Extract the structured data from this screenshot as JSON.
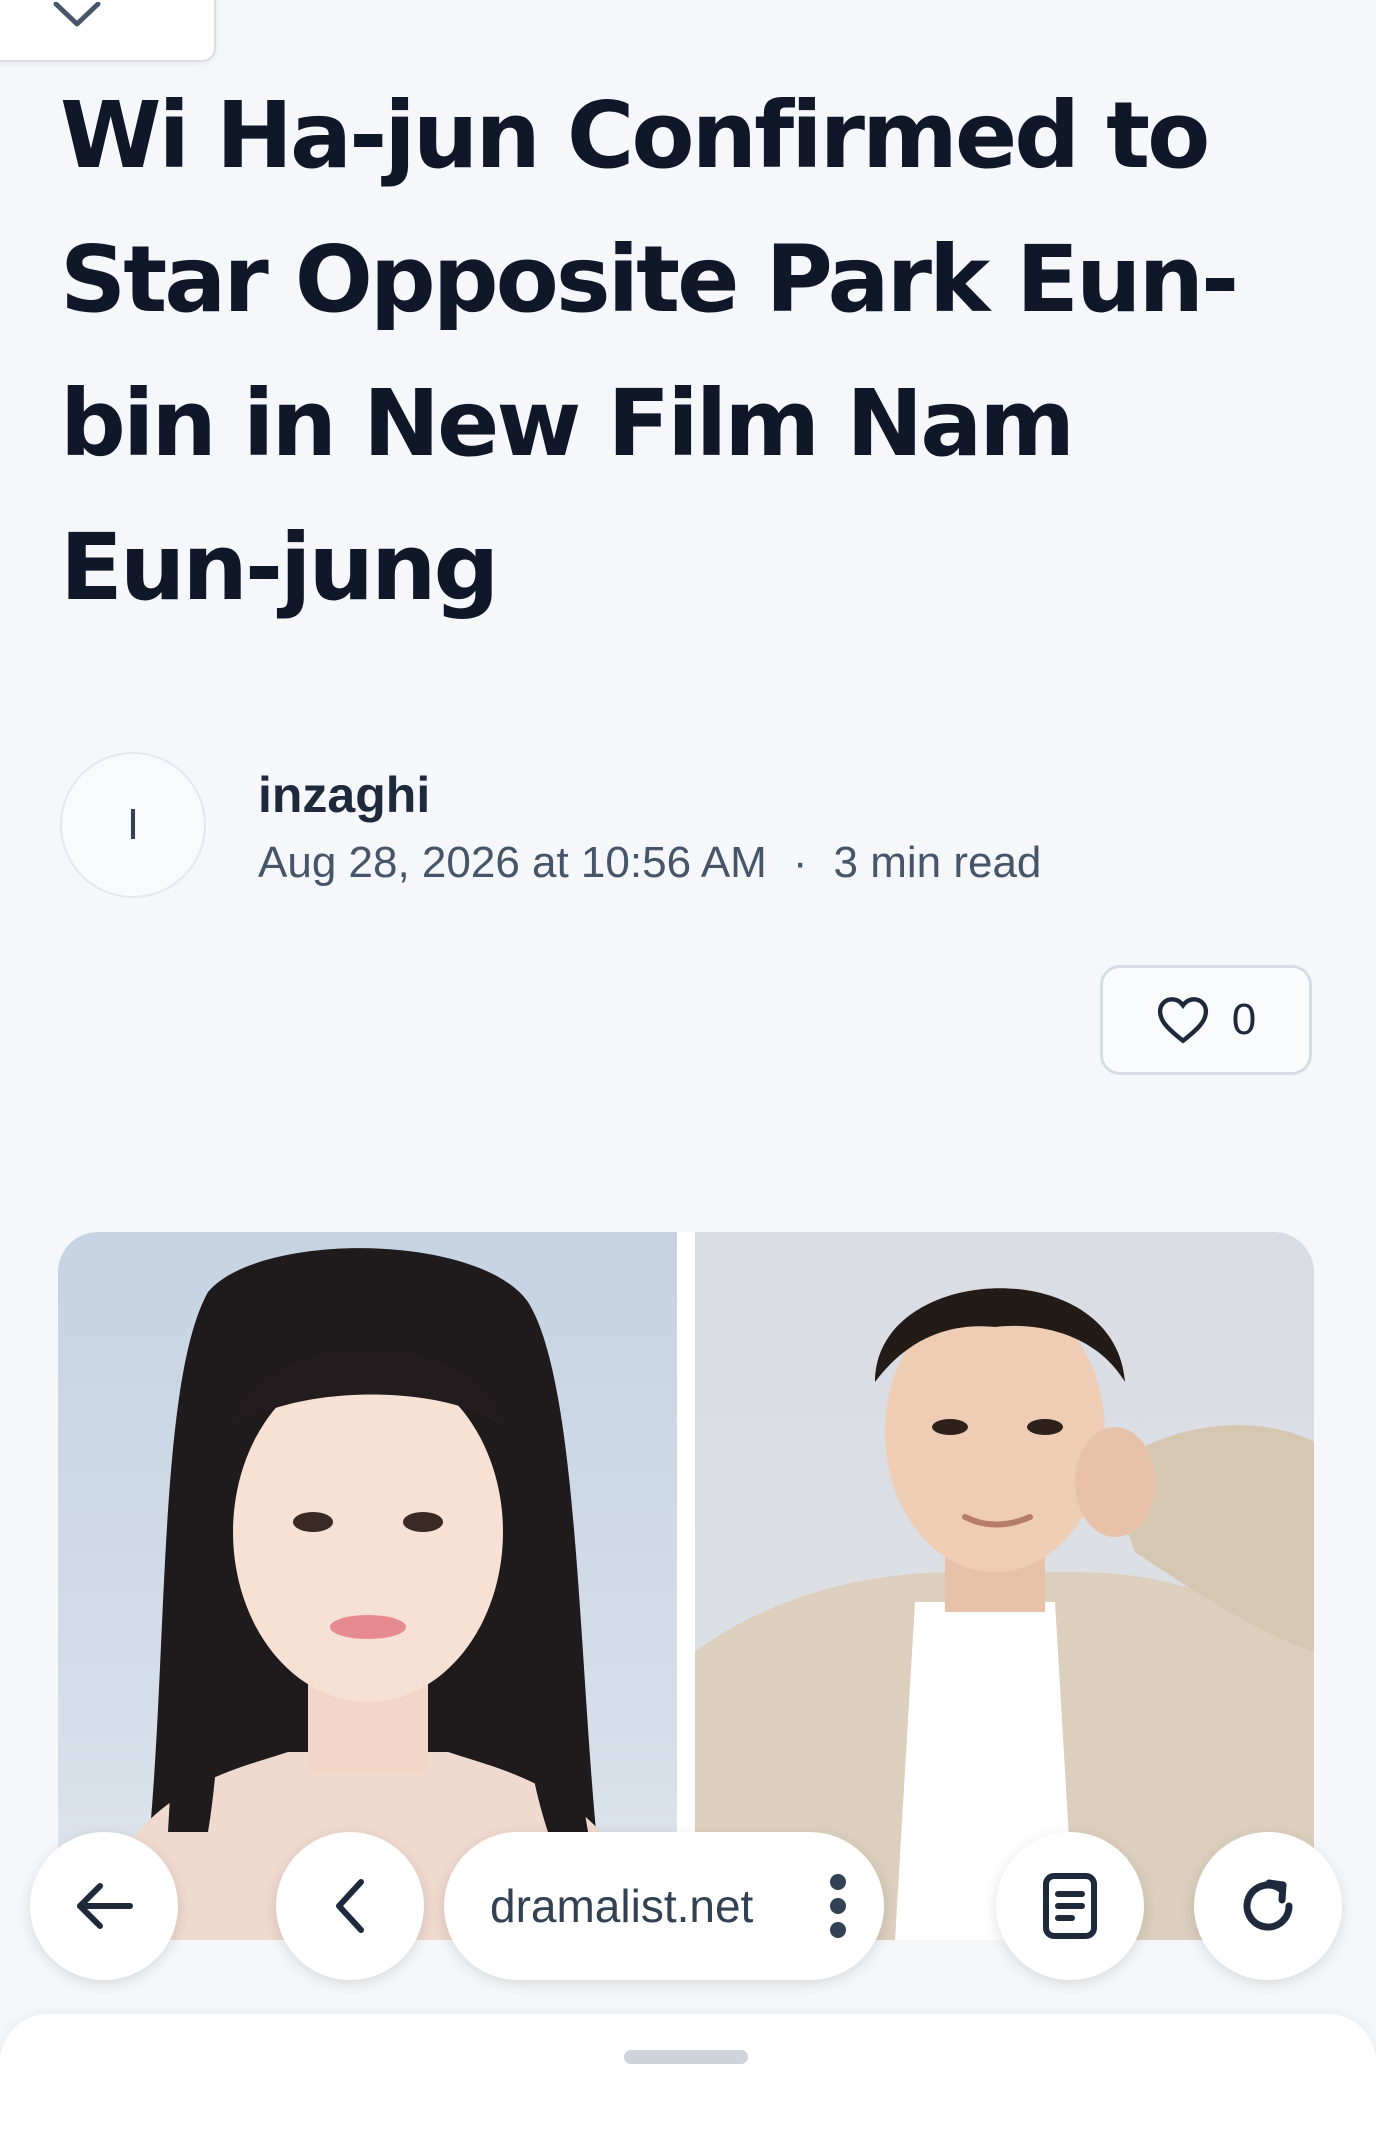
{
  "article": {
    "title": "Wi Ha-jun Confirmed to Star Opposite Park Eun-bin in New Film Nam Eun-jung",
    "author": {
      "initial": "I",
      "name": "inzaghi"
    },
    "date": "Aug 28, 2026 at 10:56 AM",
    "separator": "·",
    "read_time": "3 min read",
    "likes": "0"
  },
  "browser": {
    "url": "dramalist.net"
  },
  "icons": {
    "dropdown": "chevron-down-icon",
    "like": "heart-icon",
    "back": "arrow-left-icon",
    "prev": "chevron-left-icon",
    "menu": "kebab-menu-icon",
    "reader": "document-icon",
    "reload": "reload-icon"
  }
}
